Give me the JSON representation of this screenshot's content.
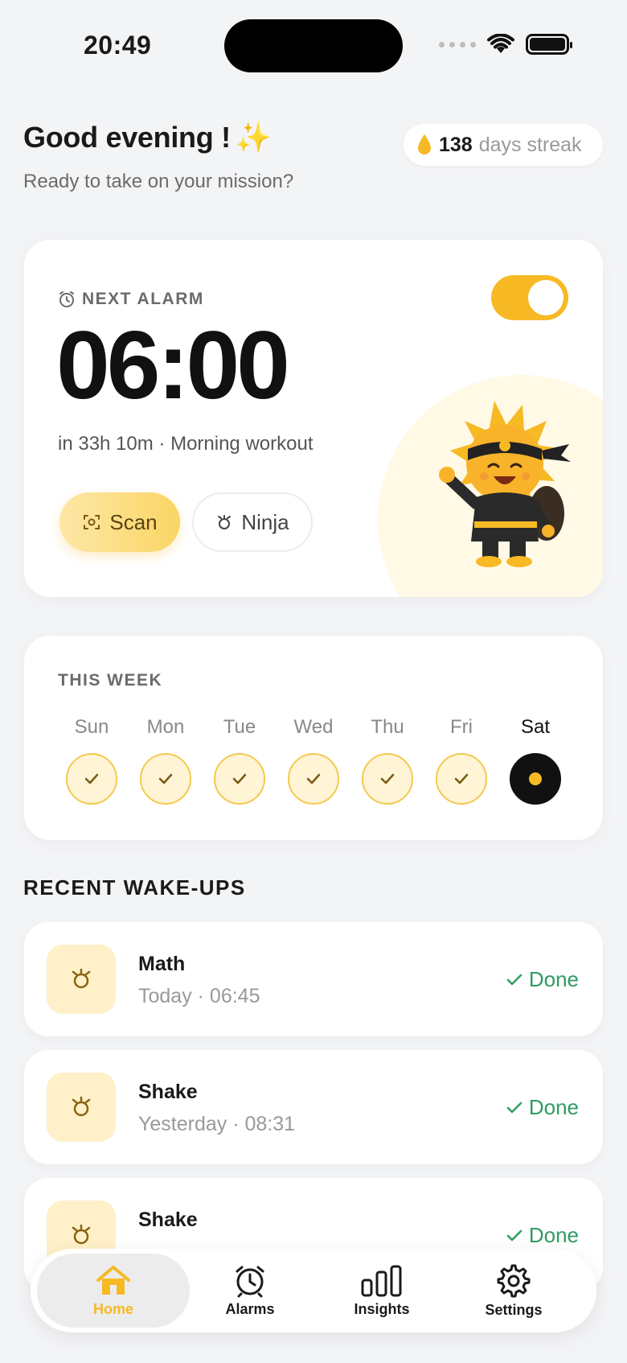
{
  "status_bar": {
    "time": "20:49"
  },
  "header": {
    "greeting": "Good evening !",
    "sparkle": "✨",
    "subtitle": "Ready to take on your mission?",
    "streak_count": "138",
    "streak_label": "days streak"
  },
  "alarm": {
    "label": "NEXT ALARM",
    "time": "06:00",
    "meta": "in 33h 10m · Morning workout",
    "enabled": true,
    "scan_label": "Scan",
    "ninja_label": "Ninja"
  },
  "week": {
    "title": "THIS WEEK",
    "days": [
      {
        "name": "Sun",
        "state": "done"
      },
      {
        "name": "Mon",
        "state": "done"
      },
      {
        "name": "Tue",
        "state": "done"
      },
      {
        "name": "Wed",
        "state": "done"
      },
      {
        "name": "Thu",
        "state": "done"
      },
      {
        "name": "Fri",
        "state": "done"
      },
      {
        "name": "Sat",
        "state": "today"
      }
    ]
  },
  "recent": {
    "title": "RECENT WAKE-UPS",
    "items": [
      {
        "title": "Math",
        "time": "Today · 06:45",
        "status": "Done"
      },
      {
        "title": "Shake",
        "time": "Yesterday · 08:31",
        "status": "Done"
      },
      {
        "title": "Shake",
        "time": "",
        "status": "Done"
      }
    ]
  },
  "tabs": [
    {
      "label": "Home",
      "icon": "home-icon",
      "active": true
    },
    {
      "label": "Alarms",
      "icon": "alarm-clock-icon",
      "active": false
    },
    {
      "label": "Insights",
      "icon": "bar-chart-icon",
      "active": false
    },
    {
      "label": "Settings",
      "icon": "gear-icon",
      "active": false
    }
  ],
  "colors": {
    "accent": "#F7B924",
    "success": "#2E9C63",
    "background": "#F3F4F6"
  }
}
